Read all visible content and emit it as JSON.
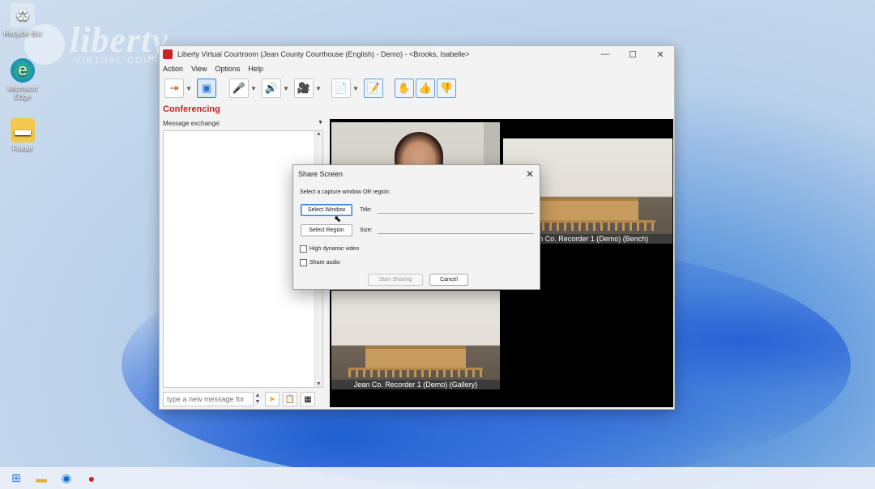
{
  "desktop": {
    "icons": [
      {
        "label": "Recycle Bin",
        "icon": "recycle-bin-icon"
      },
      {
        "label": "Microsoft Edge",
        "icon": "edge-icon"
      },
      {
        "label": "Folder",
        "icon": "folder-icon"
      }
    ],
    "watermark": {
      "brand": "liberty",
      "tagline": "VIRTUAL COURTROOM"
    }
  },
  "window": {
    "title": "Liberty Virtual Courtroom (Jean County Courthouse (English) - Demo) - <Brooks, Isabelle>",
    "controls": {
      "minimize": "—",
      "maximize": "☐",
      "close": "✕"
    },
    "menu": [
      "Action",
      "View",
      "Options",
      "Help"
    ],
    "section_title": "Conferencing",
    "message_exchange_label": "Message exchange:",
    "message_input_placeholder": "type a new message for",
    "video_tiles": [
      {
        "label": ""
      },
      {
        "label": "Jean Co. Recorder 1 (Demo) (Bench)"
      },
      {
        "label": "Jean Co. Recorder 1 (Demo) (Gallery)"
      }
    ]
  },
  "dialog": {
    "title": "Share Screen",
    "prompt": "Select a capture window OR region:",
    "select_window": "Select Window",
    "select_region": "Select Region",
    "title_label": "Title:",
    "size_label": "Size:",
    "title_value": "",
    "size_value": "",
    "high_dynamic_video": "High dynamic video",
    "share_audio": "Share audio",
    "start_sharing": "Start Sharing",
    "cancel": "Cancel"
  },
  "colors": {
    "accent": "#c0261e",
    "focus": "#3a7bd5"
  }
}
